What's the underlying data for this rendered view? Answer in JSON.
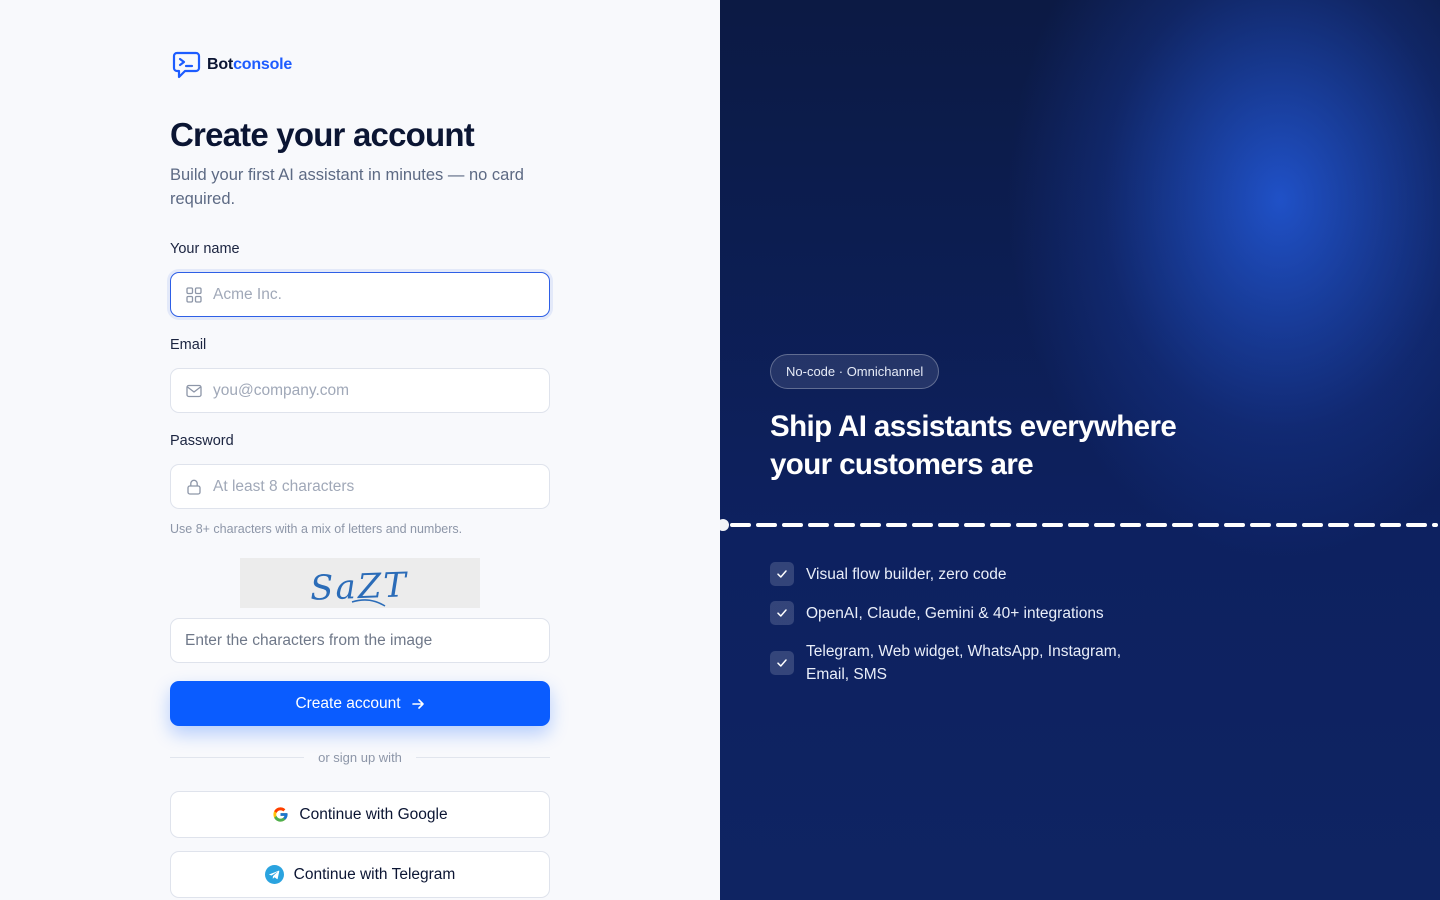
{
  "brand": {
    "name_part1": "Bot",
    "name_part2": "console",
    "accent": "#0a5cff"
  },
  "form": {
    "title": "Create your account",
    "subtitle": "Build your first AI assistant in minutes — no card required.",
    "name_label": "Your name",
    "name_placeholder": "Acme Inc.",
    "email_label": "Email",
    "email_placeholder": "you@company.com",
    "password_label": "Password",
    "password_placeholder": "At least 8 characters",
    "password_hint": "Use 8+ characters with a mix of letters and numbers.",
    "captcha_text": "SaZT",
    "captcha_placeholder": "Enter the characters from the image",
    "submit_label": "Create account",
    "divider_text": "or sign up with",
    "google_label": "Continue with Google",
    "telegram_label": "Continue with Telegram"
  },
  "promo": {
    "badge": "No-code · Omnichannel",
    "headline": "Ship AI assistants everywhere your customers are",
    "features": [
      {
        "text": "Visual flow builder, zero code"
      },
      {
        "text": "OpenAI, Claude, Gemini & 40+ integrations"
      },
      {
        "text": "Telegram, Web widget, WhatsApp, Instagram, Email, SMS"
      }
    ]
  },
  "icons": {
    "logo": "chat-terminal-icon",
    "name_field": "grid-icon",
    "email_field": "mail-icon",
    "password_field": "lock-icon",
    "submit": "arrow-right-icon",
    "google": "google-icon",
    "telegram": "telegram-icon",
    "feature": "check-icon"
  }
}
